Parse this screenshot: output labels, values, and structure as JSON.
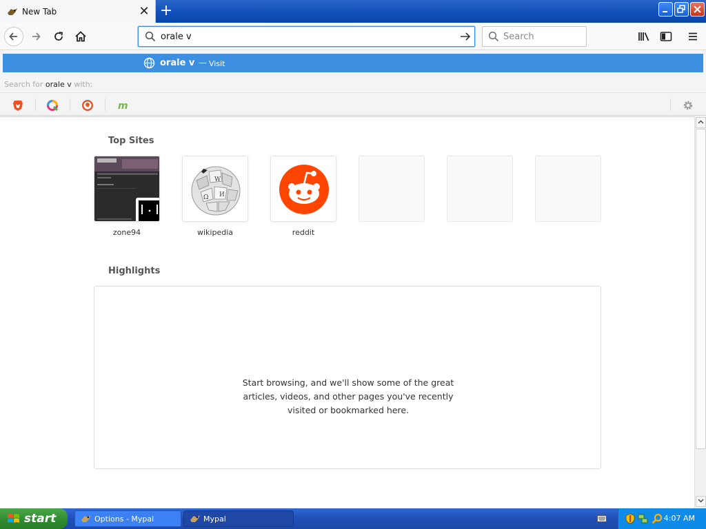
{
  "window": {
    "tab_title": "New Tab",
    "close_tab_glyph": "✕",
    "new_tab_glyph": "+",
    "controls": [
      "minimize",
      "restore",
      "close"
    ]
  },
  "navbar": {
    "url_value": "orale v",
    "search_placeholder": "Search"
  },
  "autocomplete": {
    "suggestion_text": "orale v",
    "suggestion_dash": "—",
    "suggestion_action": "Visit",
    "search_for_prefix": "Search for ",
    "search_for_term": "orale v",
    "search_for_suffix": " with:",
    "engines": [
      "brave-search-icon",
      "qwant-icon",
      "duckduckgo-icon",
      "mojeek-icon"
    ]
  },
  "newtab": {
    "top_sites_title": "Top Sites",
    "top_sites": [
      {
        "label": "zone94",
        "icon": "zone94-thumbnail"
      },
      {
        "label": "wikipedia",
        "icon": "wikipedia-globe-icon"
      },
      {
        "label": "reddit",
        "icon": "reddit-icon"
      },
      {
        "label": "",
        "icon": ""
      },
      {
        "label": "",
        "icon": ""
      },
      {
        "label": "",
        "icon": ""
      }
    ],
    "highlights_title": "Highlights",
    "highlights_message": "Start browsing, and we'll show some of the great articles, videos, and other pages you've recently visited or bookmarked here."
  },
  "taskbar": {
    "start_label": "start",
    "tasks": [
      {
        "label": "Options - Mypal"
      },
      {
        "label": "Mypal"
      }
    ],
    "clock": "4:07 AM"
  },
  "colors": {
    "accent": "#3c8fe0",
    "reddit": "#ff4500",
    "titlebar": "#0f4fb8",
    "start_green": "#2e8a2c"
  }
}
